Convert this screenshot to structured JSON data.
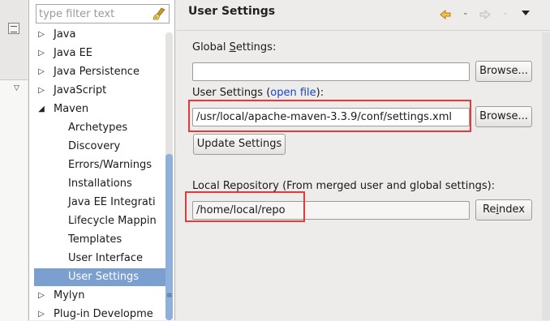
{
  "filter": {
    "placeholder": "type filter text"
  },
  "tree": {
    "items": [
      {
        "label": "Java",
        "twisty": "▷",
        "level": 0
      },
      {
        "label": "Java EE",
        "twisty": "▷",
        "level": 0
      },
      {
        "label": "Java Persistence",
        "twisty": "▷",
        "level": 0
      },
      {
        "label": "JavaScript",
        "twisty": "▷",
        "level": 0
      },
      {
        "label": "Maven",
        "twisty": "◢",
        "level": 0
      },
      {
        "label": "Archetypes",
        "level": 1
      },
      {
        "label": "Discovery",
        "level": 1
      },
      {
        "label": "Errors/Warnings",
        "level": 1
      },
      {
        "label": "Installations",
        "level": 1
      },
      {
        "label": "Java EE Integrati",
        "level": 1
      },
      {
        "label": "Lifecycle Mappin",
        "level": 1
      },
      {
        "label": "Templates",
        "level": 1
      },
      {
        "label": "User Interface",
        "level": 1
      },
      {
        "label": "User Settings",
        "level": 1,
        "selected": true
      },
      {
        "label": "Mylyn",
        "twisty": "▷",
        "level": 0
      },
      {
        "label": "Plug-in Developme",
        "twisty": "▷",
        "level": 0
      }
    ]
  },
  "page": {
    "title": "User Settings",
    "global_settings_label_pre": "Global ",
    "global_settings_label_u": "S",
    "global_settings_label_post": "ettings:",
    "global_settings_value": "",
    "browse_label": "Browse...",
    "user_settings_label_pre": "User Settings (",
    "user_settings_link": "open file",
    "user_settings_label_post": "):",
    "user_settings_value": "/usr/local/apache-maven-3.3.9/conf/settings.xml",
    "update_settings_label": "Update Settings",
    "local_repo_label": "Local Repository (From merged user and global settings):",
    "local_repo_value": "/home/local/repo",
    "reindex_pre": "Re",
    "reindex_u": "i",
    "reindex_post": "ndex"
  },
  "colors": {
    "highlight": "#e23a3a",
    "selection": "#7b9fcf",
    "link": "#1744c4",
    "nav_arrow": "#e8a928"
  }
}
